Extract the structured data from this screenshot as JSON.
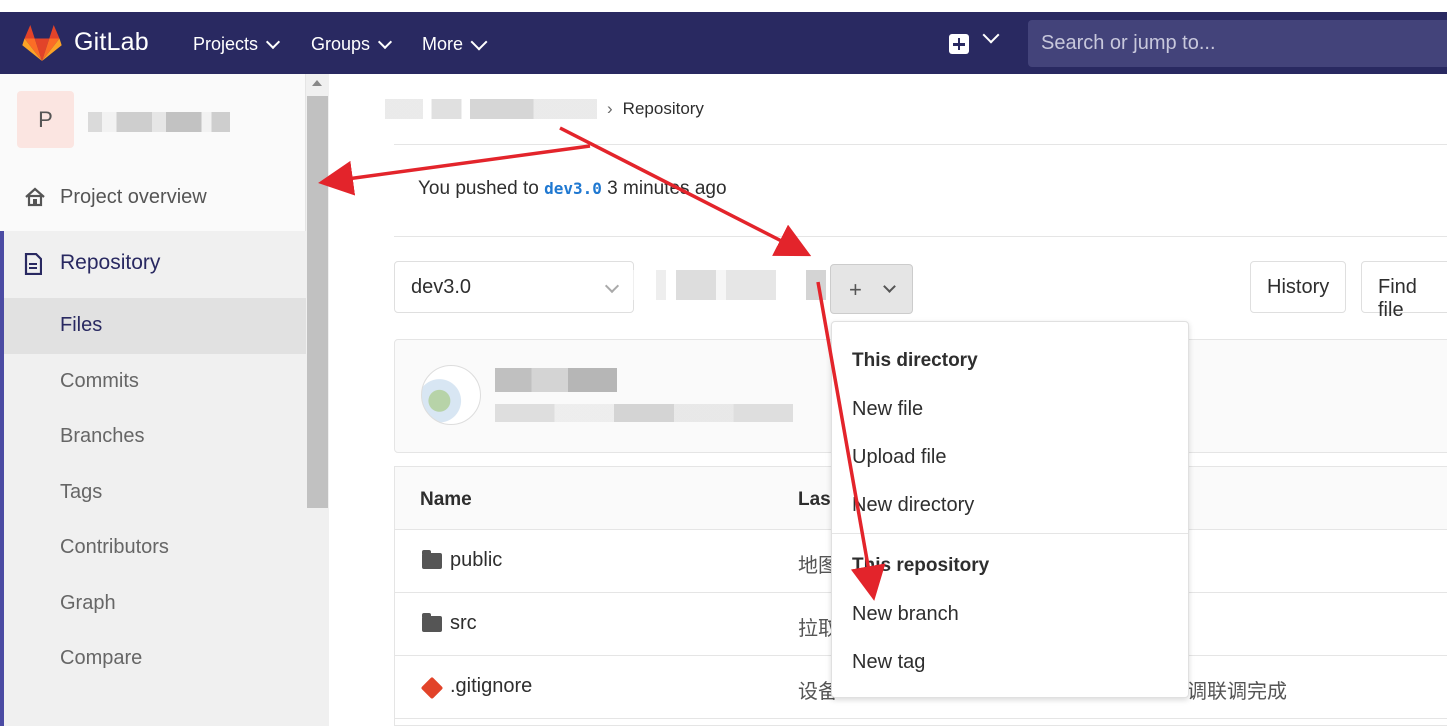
{
  "navbar": {
    "brand": "GitLab",
    "items": [
      "Projects",
      "Groups",
      "More"
    ],
    "search_placeholder": "Search or jump to...",
    "bg_color": "#292961"
  },
  "sidebar": {
    "project_initial": "P",
    "overview": "Project overview",
    "repository": "Repository",
    "sub_items": [
      "Files",
      "Commits",
      "Branches",
      "Tags",
      "Contributors",
      "Graph",
      "Compare"
    ],
    "active": "Files"
  },
  "breadcrumb": {
    "current": "Repository"
  },
  "push_notice": {
    "prefix": "You pushed to",
    "branch": "dev3.0",
    "suffix": "3 minutes ago"
  },
  "toolbar": {
    "branch": "dev3.0",
    "add_label": "+",
    "history": "History",
    "find_file": "Find file"
  },
  "table": {
    "headers": {
      "name": "Name",
      "last_commit": "Last commit"
    },
    "rows": [
      {
        "name": "public",
        "type": "folder",
        "msg": "地图"
      },
      {
        "name": "src",
        "type": "folder",
        "msg": "拉取"
      },
      {
        "name": ".gitignore",
        "type": "git",
        "msg": "设备"
      }
    ],
    "row3_tail": "调联调完成"
  },
  "dropdown": {
    "section1": "This directory",
    "items1": [
      "New file",
      "Upload file",
      "New directory"
    ],
    "section2": "This repository",
    "items2": [
      "New branch",
      "New tag"
    ]
  },
  "annotation_color": "#e3242b"
}
